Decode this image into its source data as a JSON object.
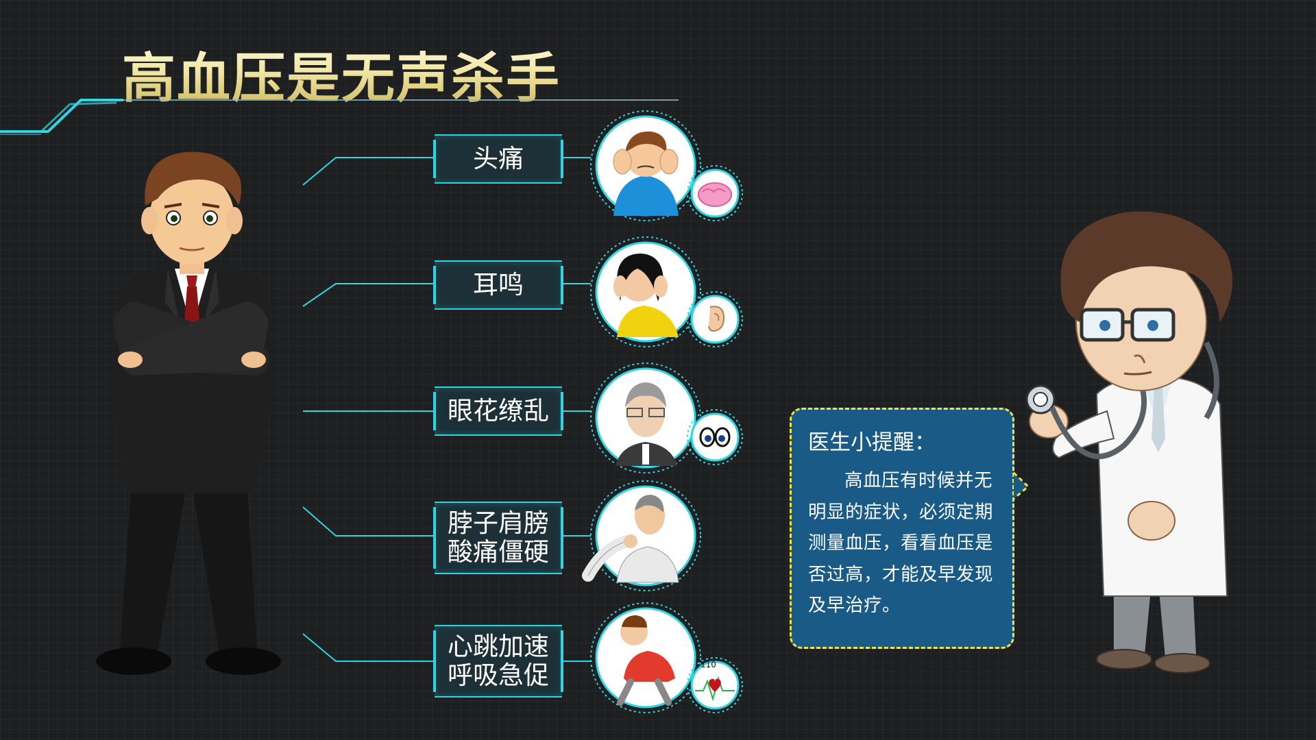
{
  "title": "高血压是无声杀手",
  "symptoms": [
    {
      "label_lines": [
        "头痛"
      ],
      "icon": "brain-icon"
    },
    {
      "label_lines": [
        "耳鸣"
      ],
      "icon": "ear-icon"
    },
    {
      "label_lines": [
        "眼花缭乱"
      ],
      "icon": "eyes-icon"
    },
    {
      "label_lines": [
        "脖子肩膀",
        "酸痛僵硬"
      ],
      "icon": ""
    },
    {
      "label_lines": [
        "心跳加速",
        "呼吸急促"
      ],
      "icon": "heart-rate-icon"
    }
  ],
  "heart_rate_value": "110",
  "tip": {
    "title": "医生小提醒：",
    "body": "高血压有时候并无明显的症状，必须定期测量血压，看看血压是否过高，才能及早发现及早治疗。"
  },
  "colors": {
    "background": "#1d1f21",
    "accent_cyan": "#2fd6e2",
    "title_gold": "#f3e7a5",
    "tip_box_blue": "#1a5a86",
    "tip_border_yellow": "#f5e23a"
  }
}
